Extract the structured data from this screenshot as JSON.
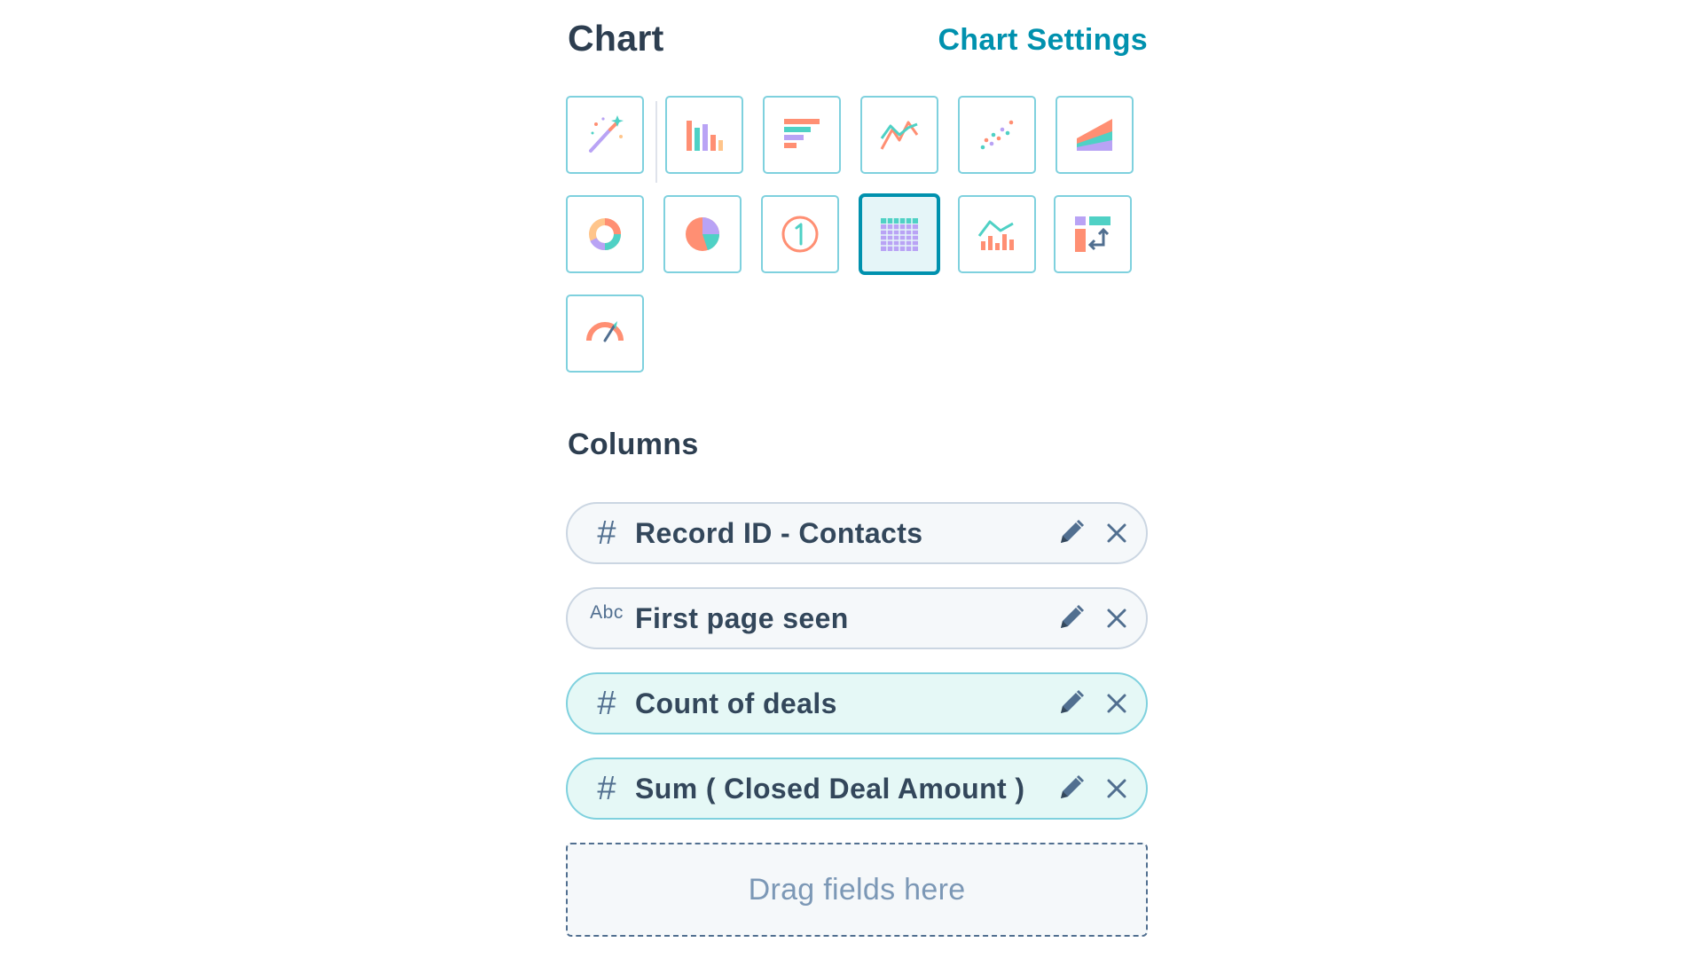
{
  "header": {
    "title": "Chart",
    "settings_link": "Chart Settings"
  },
  "chart_types": [
    {
      "icon": "magic-wand-icon",
      "name": "auto"
    },
    {
      "icon": "vertical-bar-chart-icon",
      "name": "column"
    },
    {
      "icon": "horizontal-bar-chart-icon",
      "name": "bar"
    },
    {
      "icon": "line-chart-icon",
      "name": "line"
    },
    {
      "icon": "scatter-chart-icon",
      "name": "scatter"
    },
    {
      "icon": "area-chart-icon",
      "name": "area"
    },
    {
      "icon": "donut-chart-icon",
      "name": "donut"
    },
    {
      "icon": "pie-chart-icon",
      "name": "pie"
    },
    {
      "icon": "summary-number-icon",
      "name": "summary"
    },
    {
      "icon": "table-chart-icon",
      "name": "table",
      "selected": true
    },
    {
      "icon": "combo-chart-icon",
      "name": "combination"
    },
    {
      "icon": "pivot-table-icon",
      "name": "pivot"
    },
    {
      "icon": "gauge-chart-icon",
      "name": "gauge"
    }
  ],
  "columns": {
    "label": "Columns",
    "items": [
      {
        "type_icon": "#",
        "type": "number",
        "label": "Record ID - Contacts",
        "accent": false
      },
      {
        "type_icon": "Abc",
        "type": "text",
        "label": "First page seen",
        "accent": false
      },
      {
        "type_icon": "#",
        "type": "number",
        "label": "Count of deals",
        "accent": true
      },
      {
        "type_icon": "#",
        "type": "number",
        "label": "Sum ( Closed Deal Amount )",
        "accent": true
      }
    ],
    "drop_placeholder": "Drag fields here"
  },
  "colors": {
    "accent": "#0091ae",
    "border_light": "#7fd1de",
    "text_dark": "#33475b",
    "icon_coral": "#ff8f73",
    "icon_teal": "#4fd1c5",
    "icon_purple": "#b9a3f5"
  }
}
